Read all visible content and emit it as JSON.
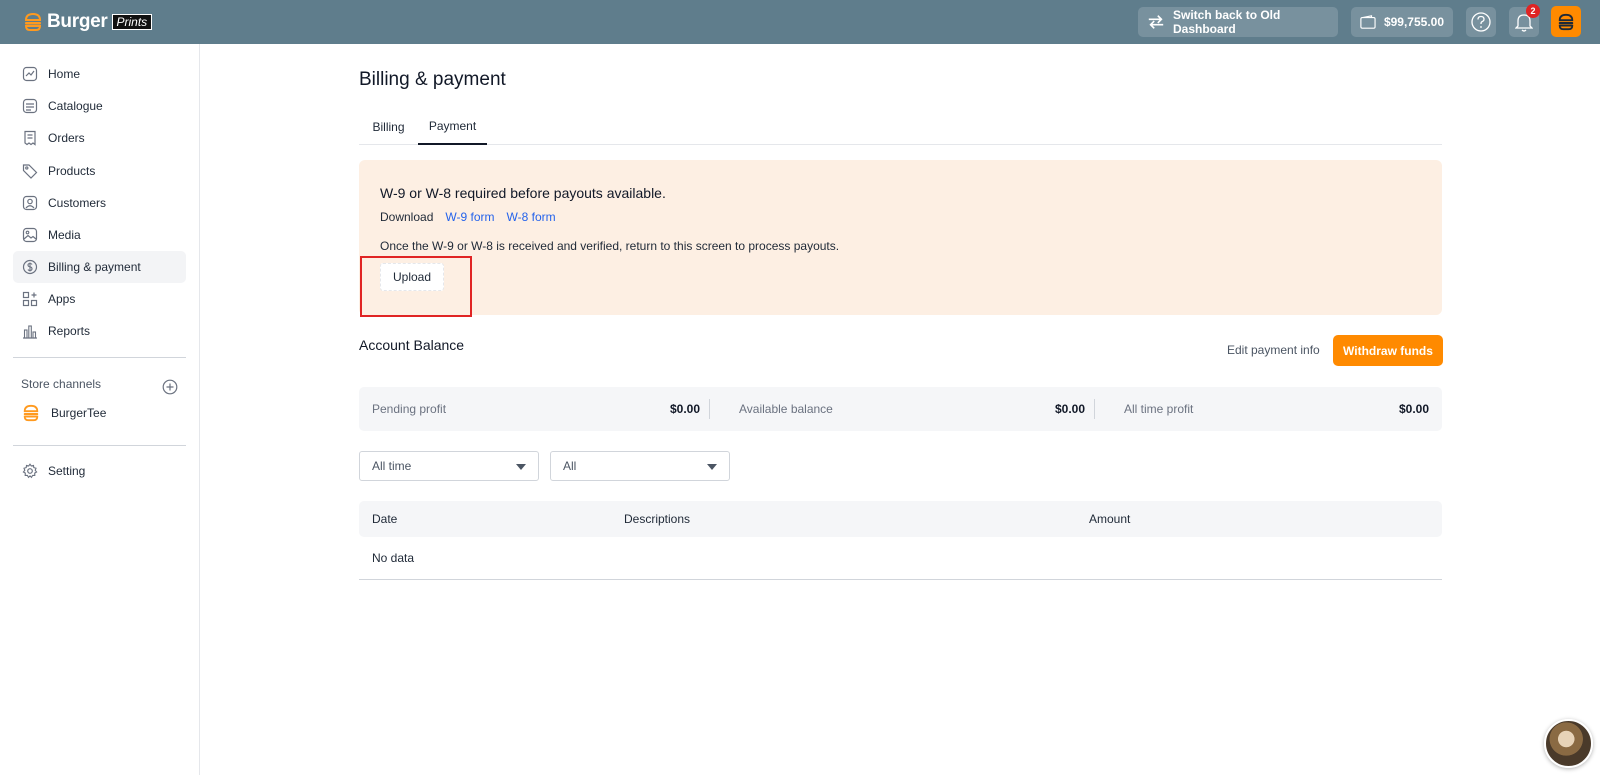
{
  "brand": {
    "name": "Burger",
    "sub": "Prints",
    "accent": "#ff8a00",
    "topbar_bg": "#5f7d8c"
  },
  "topbar": {
    "switch_label": "Switch back to Old Dashboard",
    "wallet_amount": "$99,755.00",
    "notification_count": "2"
  },
  "sidebar": {
    "items": [
      {
        "label": "Home",
        "icon": "trend-chart-icon"
      },
      {
        "label": "Catalogue",
        "icon": "catalogue-icon"
      },
      {
        "label": "Orders",
        "icon": "receipt-icon"
      },
      {
        "label": "Products",
        "icon": "tag-icon"
      },
      {
        "label": "Customers",
        "icon": "customer-icon"
      },
      {
        "label": "Media",
        "icon": "image-icon"
      },
      {
        "label": "Billing & payment",
        "icon": "dollar-circle-icon",
        "active": true
      },
      {
        "label": "Apps",
        "icon": "apps-icon"
      },
      {
        "label": "Reports",
        "icon": "bar-chart-icon"
      }
    ],
    "store_channels_title": "Store channels",
    "store_name": "BurgerTee",
    "setting_label": "Setting"
  },
  "main": {
    "title": "Billing & payment",
    "tabs": [
      {
        "label": "Billing",
        "active": false
      },
      {
        "label": "Payment",
        "active": true
      }
    ],
    "notice": {
      "title": "W-9 or W-8 required before payouts available.",
      "download_label": "Download",
      "w9_link": "W-9 form",
      "w8_link": "W-8 form",
      "message": "Once the W-9 or W-8 is received and verified, return to this screen to process payouts.",
      "upload_label": "Upload"
    },
    "balance": {
      "title": "Account Balance",
      "edit_label": "Edit payment info",
      "withdraw_label": "Withdraw funds",
      "items": [
        {
          "label": "Pending profit",
          "value": "$0.00"
        },
        {
          "label": "Available balance",
          "value": "$0.00"
        },
        {
          "label": "All time profit",
          "value": "$0.00"
        }
      ]
    },
    "filters": {
      "period": "All time",
      "type": "All"
    },
    "table": {
      "columns": [
        "Date",
        "Descriptions",
        "Amount"
      ],
      "empty_text": "No data"
    }
  }
}
